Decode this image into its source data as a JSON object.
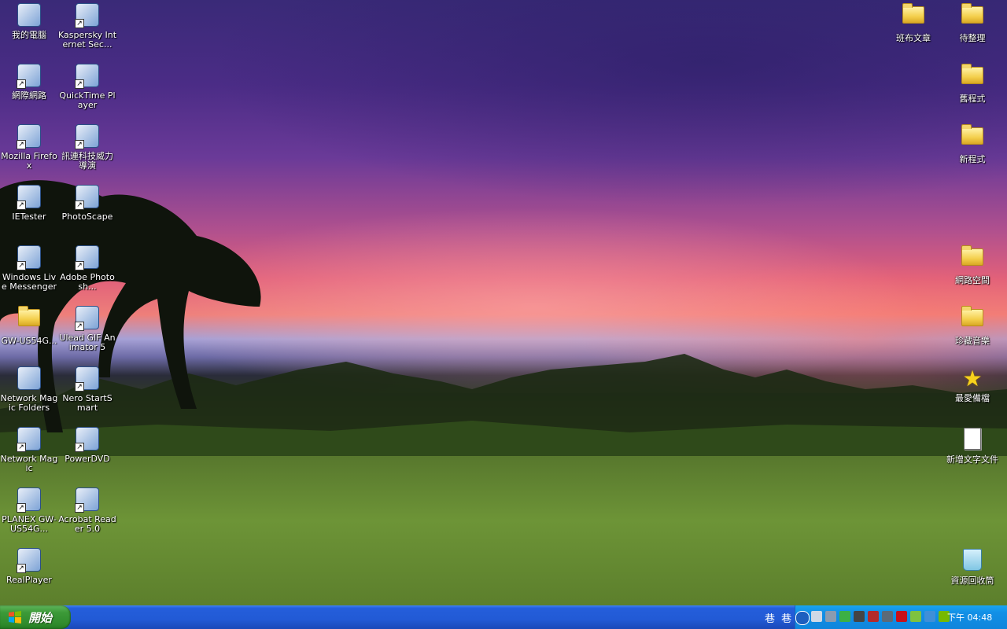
{
  "desktop_icons_left": [
    {
      "label": "我的電腦",
      "icon": "my-computer-icon",
      "shortcut": false
    },
    {
      "label": "Kaspersky Internet Sec...",
      "icon": "kaspersky-icon",
      "shortcut": true
    },
    {
      "label": "網際網路",
      "icon": "internet-explorer-icon",
      "shortcut": true
    },
    {
      "label": "QuickTime Player",
      "icon": "quicktime-icon",
      "shortcut": true
    },
    {
      "label": "Mozilla Firefox",
      "icon": "firefox-icon",
      "shortcut": true
    },
    {
      "label": "訊連科技威力導演",
      "icon": "powerdirector-icon",
      "shortcut": true
    },
    {
      "label": "IETester",
      "icon": "ietester-icon",
      "shortcut": true
    },
    {
      "label": "PhotoScape",
      "icon": "photoscape-icon",
      "shortcut": true
    },
    {
      "label": "Windows Live Messenger",
      "icon": "messenger-icon",
      "shortcut": true
    },
    {
      "label": "Adobe Photosh...",
      "icon": "photoshop-icon",
      "shortcut": true
    },
    {
      "label": "GW-US54G...",
      "icon": "folder-icon",
      "shortcut": false
    },
    {
      "label": "Ulead GIF Animator 5",
      "icon": "ulead-gif-icon",
      "shortcut": true
    },
    {
      "label": "Network Magic Folders",
      "icon": "network-magic-folders-icon",
      "shortcut": false
    },
    {
      "label": "Nero StartSmart",
      "icon": "nero-icon",
      "shortcut": true
    },
    {
      "label": "Network Magic",
      "icon": "network-magic-icon",
      "shortcut": true
    },
    {
      "label": "PowerDVD",
      "icon": "powerdvd-icon",
      "shortcut": true
    },
    {
      "label": "PLANEX GW-US54G...",
      "icon": "planex-icon",
      "shortcut": true
    },
    {
      "label": "Acrobat Reader 5.0",
      "icon": "acrobat-icon",
      "shortcut": true
    },
    {
      "label": "RealPlayer",
      "icon": "realplayer-icon",
      "shortcut": true
    }
  ],
  "desktop_icons_right": [
    {
      "label": "班布文章",
      "icon": "folder-icon"
    },
    {
      "label": "待整理",
      "icon": "folder-icon"
    },
    {
      "label": "舊程式",
      "icon": "folder-icon"
    },
    {
      "label": "新程式",
      "icon": "folder-icon"
    },
    {
      "label": "網路空間",
      "icon": "folder-icon"
    },
    {
      "label": "珍藏音樂",
      "icon": "folder-icon"
    },
    {
      "label": "最愛備檔",
      "icon": "star-icon"
    },
    {
      "label": "新增文字文件",
      "icon": "text-document-icon"
    },
    {
      "label": "資源回收筒",
      "icon": "recycle-bin-icon"
    }
  ],
  "taskbar": {
    "start_label": "開始",
    "language_bar": [
      "巷",
      "巷"
    ],
    "clock": "下午 04:48"
  },
  "colors": {
    "taskbar": "#245edb",
    "start_button": "#3c9a38",
    "tray": "#0f85dc"
  }
}
